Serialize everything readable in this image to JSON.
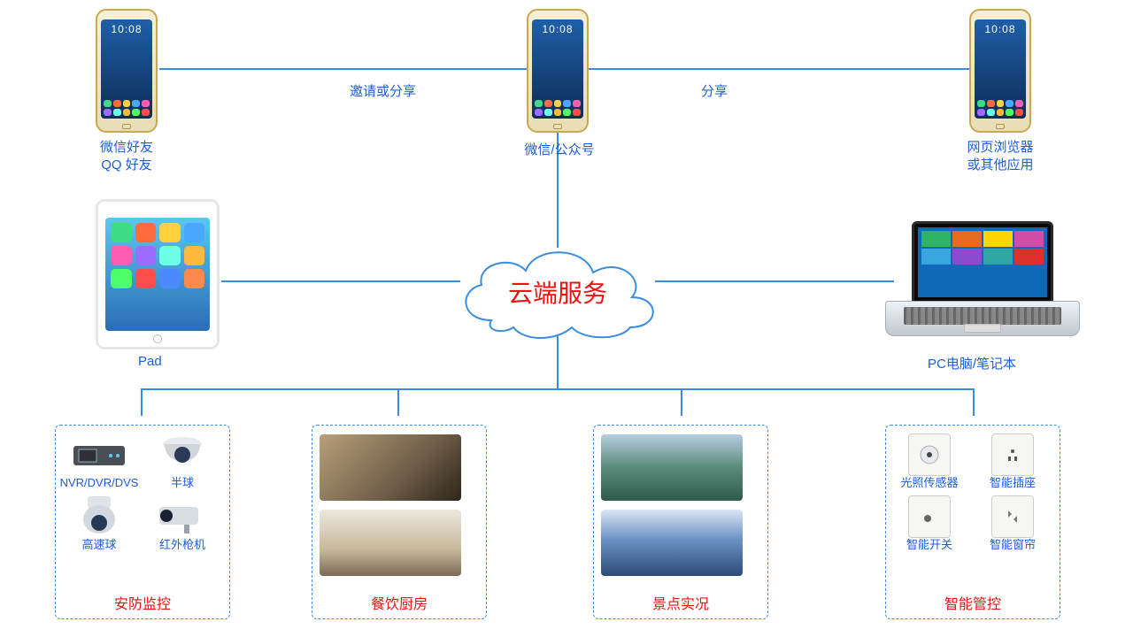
{
  "cloud": {
    "label": "云端服务"
  },
  "top": {
    "left_line1": "微信好友",
    "left_line2": "QQ 好友",
    "center": "微信/公众号",
    "right_line1": "网页浏览器",
    "right_line2": "或其他应用",
    "edge_left": "邀请或分享",
    "edge_right": "分享"
  },
  "mid": {
    "pad": "Pad",
    "pc": "PC电脑/笔记本"
  },
  "phone_clock": "10:08",
  "cat": {
    "security": {
      "title": "安防监控",
      "items": [
        "NVR/DVR/DVS",
        "半球",
        "高速球",
        "红外枪机"
      ]
    },
    "kitchen": {
      "title": "餐饮厨房"
    },
    "scenic": {
      "title": "景点实况"
    },
    "smart": {
      "title": "智能管控",
      "items": [
        "光照传感器",
        "智能插座",
        "智能开关",
        "智能窗帘"
      ]
    }
  }
}
